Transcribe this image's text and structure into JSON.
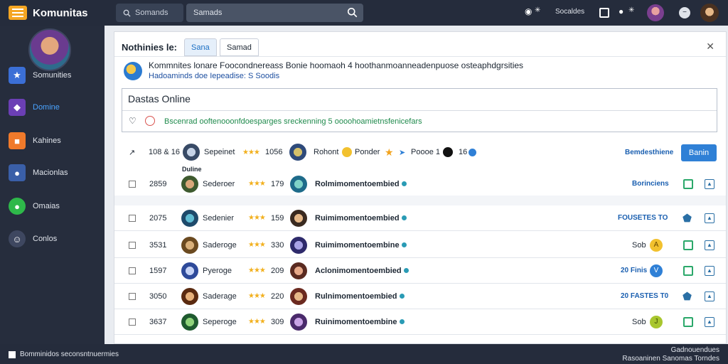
{
  "topbar": {
    "brand": "Komunitas",
    "search_small": "Somands",
    "search_main": "Samads",
    "link": "Socaldes"
  },
  "sidebar": {
    "items": [
      {
        "label": "Somunities",
        "icon": "community-icon",
        "color": "#3b6fd6",
        "active": false
      },
      {
        "label": "Domine",
        "icon": "game-icon",
        "color": "#6b3fb5",
        "active": true
      },
      {
        "label": "Kahines",
        "icon": "chat-icon",
        "color": "#f07a2b",
        "active": false
      },
      {
        "label": "Macionlas",
        "icon": "people-icon",
        "color": "#3a5fa8",
        "active": false
      },
      {
        "label": "Omaias",
        "icon": "message-icon",
        "color": "#2eb84a",
        "active": false
      },
      {
        "label": "Conlos",
        "icon": "user-icon",
        "color": "#3e4760",
        "active": false
      }
    ]
  },
  "panel": {
    "title": "Nothinies le:",
    "tabs": [
      "Sana",
      "Samad"
    ],
    "info_line1": "Kommnites lonare  Foocondnereass  Bonie hoomaoh  4  hoothanmoanneadenpuose  osteaphdgrsities",
    "info_line2": "Hadoaminds doe Iepeadise: S Soodis",
    "online_header": "Dastas Online",
    "online_message": "Bscenrad  ooftenooonfdoesparges sreckenning  5  oooohoamietnsfenicefars"
  },
  "table": {
    "header": {
      "count": "108 & 16",
      "name": "Sepeinet",
      "rating": "1056",
      "author": "Rohont",
      "game": "Ponder",
      "count2": "Poooe 1",
      "extra": "16",
      "tag": "Bemdesthiene",
      "button": "Banin"
    },
    "sublabel": "Duline",
    "rows": [
      {
        "id": "2859",
        "name": "Sederoer",
        "rating": "179",
        "title": "Rolmimomentoembied",
        "tag": "Borinciens",
        "tag2": "",
        "star": false
      },
      {
        "id": "2075",
        "name": "Sedenier",
        "rating": "159",
        "title": "Ruimimomentoembied",
        "tag": "FOUSETES TO",
        "tag2": "",
        "star": true
      },
      {
        "id": "3531",
        "name": "Saderoge",
        "rating": "330",
        "title": "Ruimimomentoembine",
        "tag": "Sob",
        "tag2": "A",
        "star": false
      },
      {
        "id": "1597",
        "name": "Pyeroge",
        "rating": "209",
        "title": "Aclonimomentoembied",
        "tag": "20 Finis",
        "tag2": "V",
        "star": false
      },
      {
        "id": "3050",
        "name": "Saderage",
        "rating": "220",
        "title": "Rulnimomentoembied",
        "tag": "20 FASTES T0",
        "tag2": "",
        "star": true
      },
      {
        "id": "3637",
        "name": "Seperoge",
        "rating": "309",
        "title": "Ruinimomentoembine",
        "tag": "Sob",
        "tag2": "J",
        "star": false
      }
    ]
  },
  "footer": {
    "left": "Bomminidos seconsntnuermies",
    "right1": "Gadnouendues",
    "right2": "Rasoaninen Sanomas Torndes"
  }
}
